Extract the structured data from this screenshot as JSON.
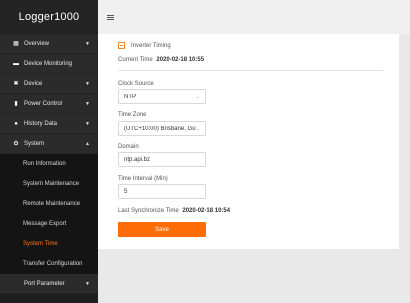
{
  "app": {
    "title": "Logger1000"
  },
  "sidebar": {
    "items": [
      {
        "label": "Overview",
        "icon": "grid-icon",
        "expandable": true
      },
      {
        "label": "Device Monitoring",
        "icon": "monitor-icon",
        "expandable": false
      },
      {
        "label": "Device",
        "icon": "tools-icon",
        "expandable": true
      },
      {
        "label": "Power Control",
        "icon": "power-icon",
        "expandable": true
      },
      {
        "label": "History Data",
        "icon": "clock-icon",
        "expandable": true
      },
      {
        "label": "System",
        "icon": "gear-icon",
        "expandable": true,
        "expanded": true
      }
    ],
    "system_sub": [
      {
        "label": "Run Information"
      },
      {
        "label": "System Maintenance"
      },
      {
        "label": "Remote Maintenance"
      },
      {
        "label": "Message Export"
      },
      {
        "label": "System Time",
        "active": true
      },
      {
        "label": "Transfer Configuration"
      }
    ],
    "port_parameter": {
      "label": "Port Parameter",
      "icon": "plug-icon"
    },
    "active_color": "#ff7a1a"
  },
  "form": {
    "inverter_timing": {
      "label": "Inverter Timing",
      "checked": false
    },
    "current_time": {
      "label": "Current Time",
      "value": "2020-02-18 10:55"
    },
    "clock_source": {
      "label": "Clock Source",
      "value": "NTP"
    },
    "time_zone": {
      "label": "Time Zone",
      "value": "(UTC+10:00) Brisbane, Gu"
    },
    "domain": {
      "label": "Domain",
      "value": "ntp.api.bz"
    },
    "time_interval": {
      "label": "Time Interval (Min)",
      "value": "5"
    },
    "last_sync": {
      "label": "Last Synchronize Time",
      "value": "2020-02-18 10:54"
    },
    "save_label": "Save",
    "accent_color": "#ff6d08"
  }
}
